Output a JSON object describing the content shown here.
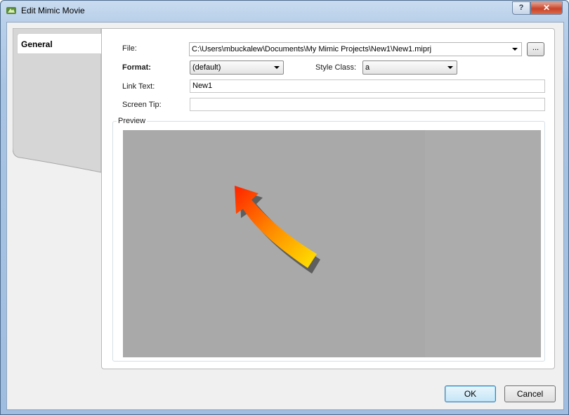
{
  "window": {
    "title": "Edit Mimic Movie",
    "help_label": "?",
    "close_label": "✕"
  },
  "tabs": [
    {
      "label": "General"
    }
  ],
  "form": {
    "file_label": "File:",
    "file_value": "C:\\Users\\mbuckalew\\Documents\\My Mimic Projects\\New1\\New1.miprj",
    "browse_label": "...",
    "format_label": "Format:",
    "format_value": "(default)",
    "style_class_label": "Style Class:",
    "style_class_value": "a",
    "link_text_label": "Link Text:",
    "link_text_value": "New1",
    "screen_tip_label": "Screen Tip:",
    "screen_tip_value": ""
  },
  "preview": {
    "label": "Preview",
    "content_icon": "arrow-icon",
    "arrow_colors": [
      "#ff2200",
      "#ff8c00",
      "#ffe600"
    ]
  },
  "buttons": {
    "ok_label": "OK",
    "cancel_label": "Cancel"
  }
}
